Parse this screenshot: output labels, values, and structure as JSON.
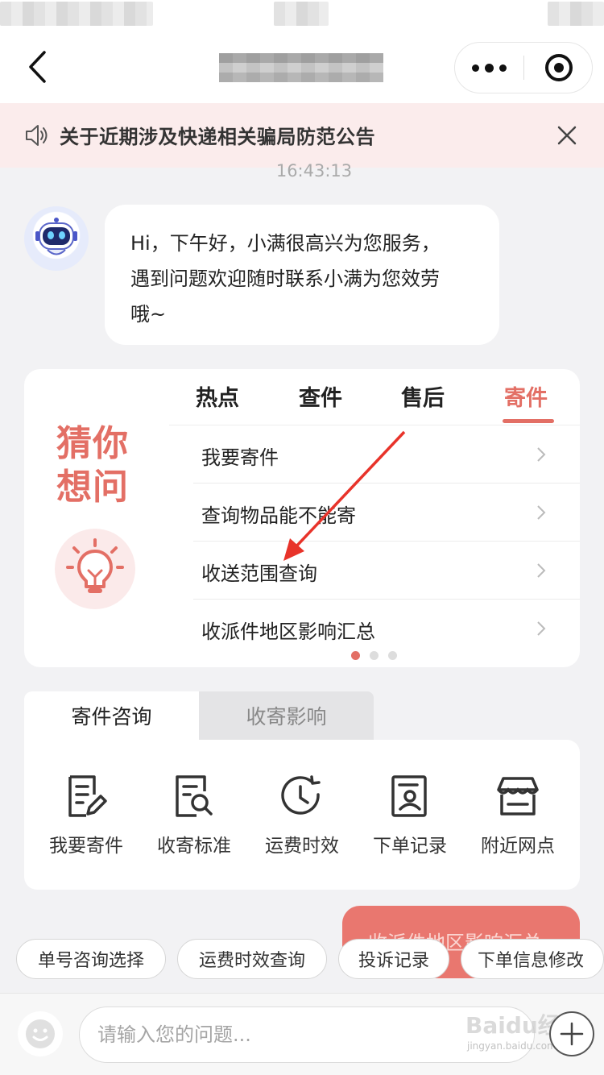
{
  "notice": {
    "text": "关于近期涉及快递相关骗局防范公告"
  },
  "chat": {
    "timestamp": "16:43:13",
    "bot_message_lines": [
      "Hi，下午好，小满很高兴为您服务，",
      "遇到问题欢迎随时联系小满为您效劳",
      "哦~"
    ],
    "user_message": "收派件地区影响汇总"
  },
  "guess_card": {
    "title_line1": "猜你",
    "title_line2": "想问",
    "tabs": [
      "热点",
      "查件",
      "售后",
      "寄件"
    ],
    "active_tab": "寄件",
    "questions": [
      "我要寄件",
      "查询物品能不能寄",
      "收送范围查询",
      "收派件地区影响汇总"
    ],
    "pages": 3,
    "current_page": 1
  },
  "service_tabs": {
    "active": "寄件咨询",
    "inactive": "收寄影响"
  },
  "services": [
    {
      "label": "我要寄件",
      "icon": "document-edit-icon"
    },
    {
      "label": "收寄标准",
      "icon": "document-search-icon"
    },
    {
      "label": "运费时效",
      "icon": "clock-icon"
    },
    {
      "label": "下单记录",
      "icon": "record-icon"
    },
    {
      "label": "附近网点",
      "icon": "store-icon"
    }
  ],
  "quick_chips": [
    "单号咨询选择",
    "运费时效查询",
    "投诉记录",
    "下单信息修改"
  ],
  "input": {
    "placeholder": "请输入您的问题..."
  },
  "watermark": {
    "brand": "Baidu经验",
    "domain": "jingyan.baidu.com"
  },
  "colors": {
    "accent": "#e36f65",
    "notice_bg": "#fbecec",
    "user_bubble": "#e9776f",
    "page_bg": "#f2f2f4"
  }
}
